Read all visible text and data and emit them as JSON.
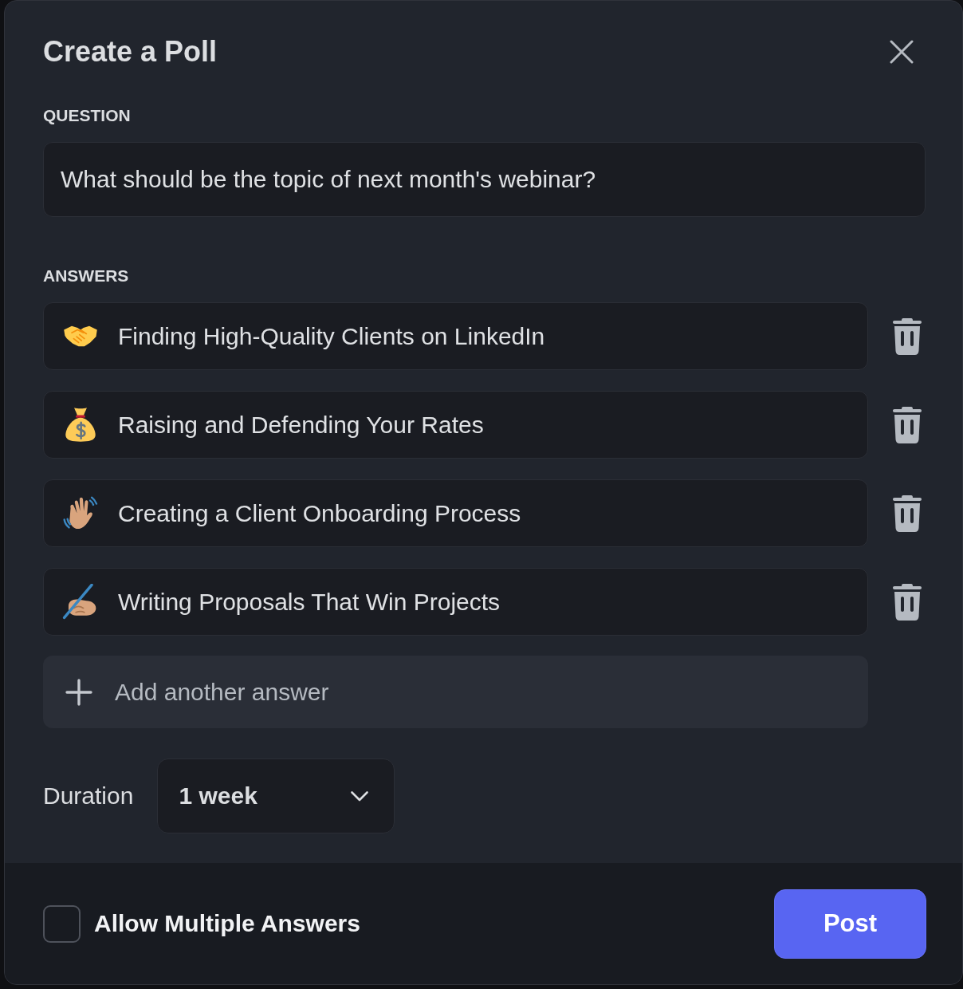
{
  "dialog": {
    "title": "Create a Poll"
  },
  "question": {
    "label": "QUESTION",
    "value": "What should be the topic of next month's webinar?"
  },
  "answers": {
    "label": "ANSWERS",
    "items": [
      {
        "kind": "handshake",
        "text": "Finding High-Quality Clients on LinkedIn"
      },
      {
        "kind": "moneybag",
        "text": "Raising and Defending Your Rates"
      },
      {
        "kind": "waving",
        "text": "Creating a Client Onboarding Process"
      },
      {
        "kind": "writing",
        "text": "Writing Proposals That Win Projects"
      }
    ]
  },
  "add_answer_button": "Add another answer",
  "duration": {
    "label": "Duration",
    "value": "1 week"
  },
  "allow_multiple": {
    "label": "Allow Multiple Answers",
    "checked": false
  },
  "post_button": "Post"
}
